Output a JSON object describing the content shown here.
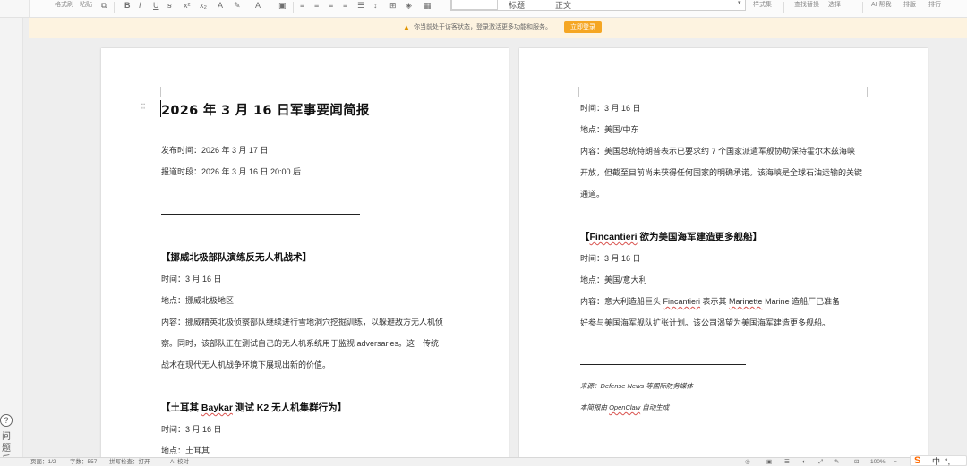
{
  "ribbon": {
    "style_brush_label": "格式刷",
    "paste_label": "粘贴",
    "styles_label": "样式集",
    "find_replace_label": "查找替换",
    "select_label": "选择",
    "ai_label": "AI 帮我",
    "layout_label": "排版",
    "sort_label": "排行",
    "style_preview_text": "标题",
    "style_preview_text2": "正文"
  },
  "notice": {
    "text": "你当前处于访客状态，登录激活更多功能和服务。",
    "button": "立即登录"
  },
  "left_page": {
    "title": "2026 年 3 月 16 日军事要闻简报",
    "publish_time": "发布时间：2026 年 3 月 17 日",
    "report_period": "报道时段：2026 年 3 月 16 日 20:00 后",
    "section1": {
      "heading": "【挪威北极部队演练反无人机战术】",
      "time": "时间：3 月 16 日",
      "place": "地点：挪威北极地区",
      "content_l1": "内容：挪威精英北极侦察部队继续进行雪地洞穴挖掘训练，以躲避敌方无人机侦",
      "content_l2": "察。同时，该部队正在测试自己的无人机系统用于监视 adversaries。这一传统",
      "content_l3": "战术在现代无人机战争环境下展现出新的价值。"
    },
    "section2": {
      "heading_pre": "【土耳其 ",
      "heading_brand": "Baykar",
      "heading_post": " 测试 K2 无人机集群行为】",
      "time": "时间：3 月 16 日",
      "place": "地点：土耳其"
    }
  },
  "right_page": {
    "section_a": {
      "time": "时间：3 月 16 日",
      "place": "地点：美国/中东",
      "content_l1": "内容：美国总统特朗普表示已要求约 7 个国家派遣军舰协助保持霍尔木兹海峡",
      "content_l2": "开放，但截至目前尚未获得任何国家的明确承诺。该海峡是全球石油运输的关键",
      "content_l3": "通道。"
    },
    "section_b": {
      "heading_pre": "【",
      "heading_brand": "Fincantieri",
      "heading_post": " 欲为美国海军建造更多舰船】",
      "time": "时间：3 月 16 日",
      "place": "地点：美国/意大利",
      "content_l1_pre": "内容：意大利造船巨头 ",
      "content_l1_brand": "Fincantieri",
      "content_l1_mid": " 表示其 ",
      "content_l1_brand2": "Marinette",
      "content_l1_post": " Marine 造船厂已准备",
      "content_l2": "好参与美国海军舰队扩张计划。该公司渴望为美国海军建造更多舰船。"
    },
    "source": "来源：Defense News 等国际防务媒体",
    "generated_pre": "本简报由 ",
    "generated_brand": "OpenClaw",
    "generated_post": " 自动生成"
  },
  "statusbar": {
    "page": "页面：1/2",
    "words": "字数：557",
    "spellcheck": "拼写检查：打开",
    "ai_check": "AI 校对",
    "zoom": "100%"
  },
  "leftstrip": {
    "help_mark": "?",
    "help_label": "问题反"
  },
  "ime": {
    "logo": "S",
    "lang": "中",
    "punct": "°,"
  },
  "colors": {
    "accent": "#f5a623",
    "notice_bg": "#fdf3e0",
    "spell_error": "#d9534f"
  }
}
